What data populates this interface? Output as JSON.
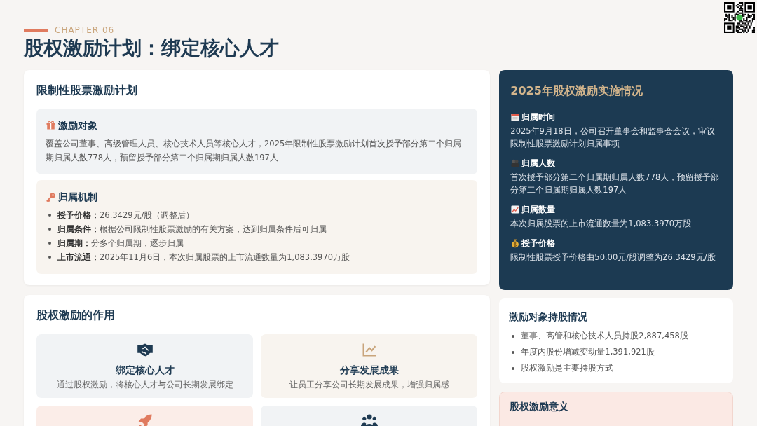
{
  "header": {
    "chapter": "CHAPTER 06",
    "title": "股权激励计划：绑定核心人才"
  },
  "plan": {
    "title": "限制性股票激励计划",
    "sections": [
      {
        "kind": "paragraph",
        "title": "激励对象",
        "text": "覆盖公司董事、高级管理人员、核心技术人员等核心人才，2025年限制性股票激励计划首次授予部分第二个归属期归属人数778人，预留授予部分第二个归属期归属人数197人"
      },
      {
        "kind": "list",
        "title": "归属机制",
        "items": [
          {
            "label": "授予价格：",
            "text": "26.3429元/股（调整后）"
          },
          {
            "label": "归属条件：",
            "text": "根据公司限制性股票激励的有关方案，达到归属条件后可归属"
          },
          {
            "label": "归属期：",
            "text": "分多个归属期，逐步归属"
          },
          {
            "label": "上市流通：",
            "text": "2025年11月6日，本次归属股票的上市流通数量为1,083.3970万股"
          }
        ]
      }
    ]
  },
  "roles": {
    "title": "股权激励的作用",
    "cards": [
      {
        "kind": "full",
        "title": "绑定核心人才",
        "text": "通过股权激励，将核心人才与公司长期发展绑定"
      },
      {
        "kind": "full",
        "title": "分享发展成果",
        "text": "让员工分享公司长期发展成果，增强归属感"
      },
      {
        "kind": "icon_only"
      },
      {
        "kind": "icon_only"
      }
    ]
  },
  "implementation": {
    "title": "2025年股权激励实施情况",
    "items": [
      {
        "title": "归属时间",
        "text": "2025年9月18日，公司召开董事会和监事会会议，审议限制性股票激励计划归属事项"
      },
      {
        "title": "归属人数",
        "text": "首次授予部分第二个归属期归属人数778人，预留授予部分第二个归属期归属人数197人"
      },
      {
        "title": "归属数量",
        "text": "本次归属股票的上市流通数量为1,083.3970万股"
      },
      {
        "title": "授予价格",
        "text": "限制性股票授予价格由50.00元/股调整为26.3429元/股"
      }
    ]
  },
  "holdings": {
    "title": "激励对象持股情况",
    "items": [
      "董事、高管和核心技术人员持股2,887,458股",
      "年度内股份增减变动量1,391,921股",
      "股权激励是主要持股方式"
    ]
  },
  "significance": {
    "title": "股权激励意义"
  }
}
